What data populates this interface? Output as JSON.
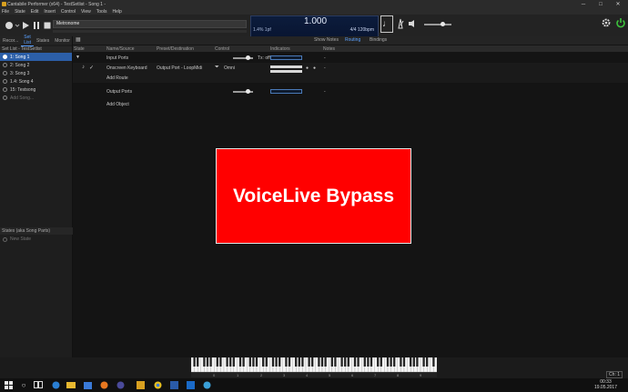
{
  "window": {
    "title": "Cantabile Performer (x64) - TestSetlist - Song 1 -",
    "minimize": "─",
    "maximize": "□",
    "close": "✕"
  },
  "menu": [
    "File",
    "State",
    "Edit",
    "Insert",
    "Control",
    "View",
    "Tools",
    "Help"
  ],
  "transport": {
    "metronome_label": "Metronome",
    "bar_display": "1.000",
    "beat_info": "1.4% 1pf",
    "time_signature": "4/4 120bpm",
    "note_symbol": "♩"
  },
  "left_tabs": [
    "Recor...",
    "Set List",
    "States",
    "Monitor"
  ],
  "setlist": {
    "header": "Set List - TestSetlist",
    "songs": [
      "1: Song 1",
      "2: Song 2",
      "3: Song 3",
      "1.4: Song 4",
      "15: Testsong"
    ],
    "add_song": "Add Song..."
  },
  "states": {
    "header": "States (aka Song Parts)",
    "new_state": "New State"
  },
  "right_tabs": {
    "show_notes": "Show Notes",
    "routing": "Routing",
    "bindings": "Bindings"
  },
  "columns": [
    "State",
    "Name/Source",
    "Preset/Destination",
    "Control",
    "Indicators",
    "Notes"
  ],
  "routing": {
    "input_ports": "Input Ports",
    "tx_off": "Tx: off",
    "input_notes": "-",
    "source": "Onscreen Keyboard",
    "destination": "Output Port - LoopMidi",
    "omni": "Omni",
    "route_notes": "-",
    "add_route": "Add Route",
    "output_ports": "Output Ports",
    "output_notes": "-",
    "add_object": "Add Object"
  },
  "overlay": {
    "text": "VoiceLive Bypass",
    "color": "#ff0000"
  },
  "keyboard": {
    "octaves": [
      "0",
      "1",
      "2",
      "3",
      "4",
      "5",
      "6",
      "7",
      "8",
      "9"
    ],
    "channel": "Ch: 1"
  },
  "taskbar": {
    "time": "00:33",
    "date": "19.05.2017"
  },
  "colors": {
    "accent": "#5aa0ff",
    "selection": "#2c5fa8",
    "power_button": "#3cc23c"
  }
}
